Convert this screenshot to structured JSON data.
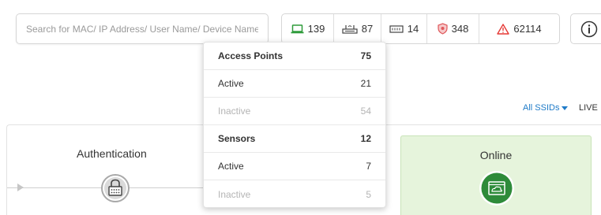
{
  "search": {
    "placeholder": "Search for MAC/ IP Address/ User Name/ Device Name..."
  },
  "stats": [
    {
      "icon": "laptop-icon",
      "value": "139",
      "color": "#2e9b3a"
    },
    {
      "icon": "access-point-icon",
      "value": "87",
      "color": "#333333"
    },
    {
      "icon": "sensor-icon",
      "value": "14",
      "color": "#333333"
    },
    {
      "icon": "shield-icon",
      "value": "348",
      "color": "#e0585b"
    },
    {
      "icon": "warning-icon",
      "value": "62114",
      "color": "#e53935"
    }
  ],
  "filters": {
    "ssids_label": "All SSIDs",
    "live_label": "LIVE"
  },
  "flow": {
    "authentication_label": "Authentication",
    "online_label": "Online"
  },
  "dropdown": {
    "rows": [
      {
        "label": "Access Points",
        "value": "75",
        "kind": "header"
      },
      {
        "label": "Active",
        "value": "21",
        "kind": "normal"
      },
      {
        "label": "Inactive",
        "value": "54",
        "kind": "muted"
      },
      {
        "label": "Sensors",
        "value": "12",
        "kind": "header"
      },
      {
        "label": "Active",
        "value": "7",
        "kind": "normal"
      },
      {
        "label": "Inactive",
        "value": "5",
        "kind": "muted"
      }
    ]
  },
  "colors": {
    "accent_blue": "#1f7bc8",
    "online_green": "#2e8b3a",
    "online_bg": "#e6f4dc"
  }
}
